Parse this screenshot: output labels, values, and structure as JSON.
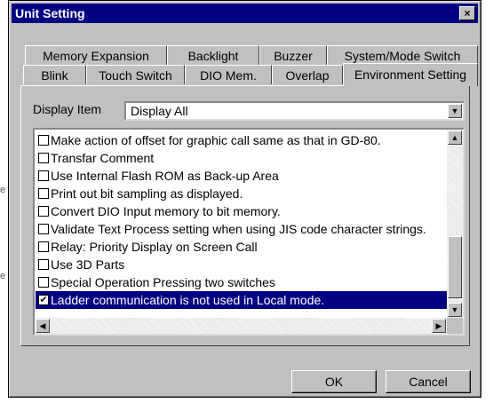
{
  "stray_text": [
    "e",
    "e"
  ],
  "window": {
    "title": "Unit Setting",
    "close_glyph": "×"
  },
  "tabs_row1": [
    "Memory Expansion",
    "Backlight",
    "Buzzer",
    "System/Mode Switch"
  ],
  "tabs_row2": [
    "Blink",
    "Touch Switch",
    "DIO Mem.",
    "Overlap",
    "Environment Setting"
  ],
  "active_tab": "Environment Setting",
  "display_item": {
    "label": "Display Item",
    "value": "Display All"
  },
  "list_items": [
    {
      "label": "Make action of offset for graphic call same as that in GD-80.",
      "checked": false
    },
    {
      "label": "Transfar Comment",
      "checked": false
    },
    {
      "label": "Use Internal Flash ROM as Back-up Area",
      "checked": false
    },
    {
      "label": "Print out bit sampling as displayed.",
      "checked": false
    },
    {
      "label": "Convert DIO Input memory to bit memory.",
      "checked": false
    },
    {
      "label": "Validate Text Process setting when using JIS code character strings.",
      "checked": false
    },
    {
      "label": "Relay: Priority Display on Screen Call",
      "checked": false
    },
    {
      "label": "Use 3D Parts",
      "checked": false
    },
    {
      "label": "Special Operation Pressing two switches",
      "checked": false
    },
    {
      "label": "Ladder communication is not used in Local mode.",
      "checked": true,
      "selected": true
    }
  ],
  "buttons": {
    "ok": "OK",
    "cancel": "Cancel"
  },
  "colors": {
    "title_bar": "#000080",
    "face": "#c0c0c0",
    "selection": "#000080"
  }
}
